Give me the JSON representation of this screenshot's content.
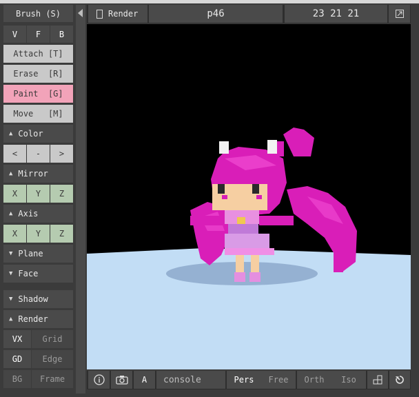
{
  "sidebar": {
    "brush_title": "Brush (S)",
    "brush_modes": [
      "V",
      "F",
      "B"
    ],
    "tools": [
      "Attach [T]",
      "Erase  [R]",
      "Paint  [G]",
      "Move   [M]"
    ],
    "color_title": "Color",
    "color_buttons": [
      "<",
      "-",
      ">"
    ],
    "mirror_title": "Mirror",
    "mirror_axes": [
      "X",
      "Y",
      "Z"
    ],
    "axis_title": "Axis",
    "axis_axes": [
      "X",
      "Y",
      "Z"
    ],
    "plane_title": "Plane",
    "face_title": "Face",
    "shadow_title": "Shadow",
    "render_title": "Render",
    "render_options": [
      "VX",
      "Grid",
      "GD",
      "Edge",
      "BG",
      "Frame"
    ]
  },
  "toolbar": {
    "render_label": "Render",
    "model_name": "p46",
    "dimensions": "23 21 21"
  },
  "bottombar": {
    "a_label": "A",
    "console_label": "console",
    "view_modes": [
      "Pers",
      "Free",
      "Orth",
      "Iso"
    ]
  },
  "colors": {
    "panel": "#3b3b3b",
    "paint_active": "#f2a3b9",
    "axis_green": "#b5cbb0",
    "ground": "#c2ddf5",
    "sky": "#000000",
    "voxel_magenta": "#e020c0"
  },
  "icons": [
    "arrow-left-icon",
    "checkbox-icon",
    "layout-icon",
    "info-icon",
    "camera-icon",
    "grid-icon",
    "rotate-icon"
  ]
}
